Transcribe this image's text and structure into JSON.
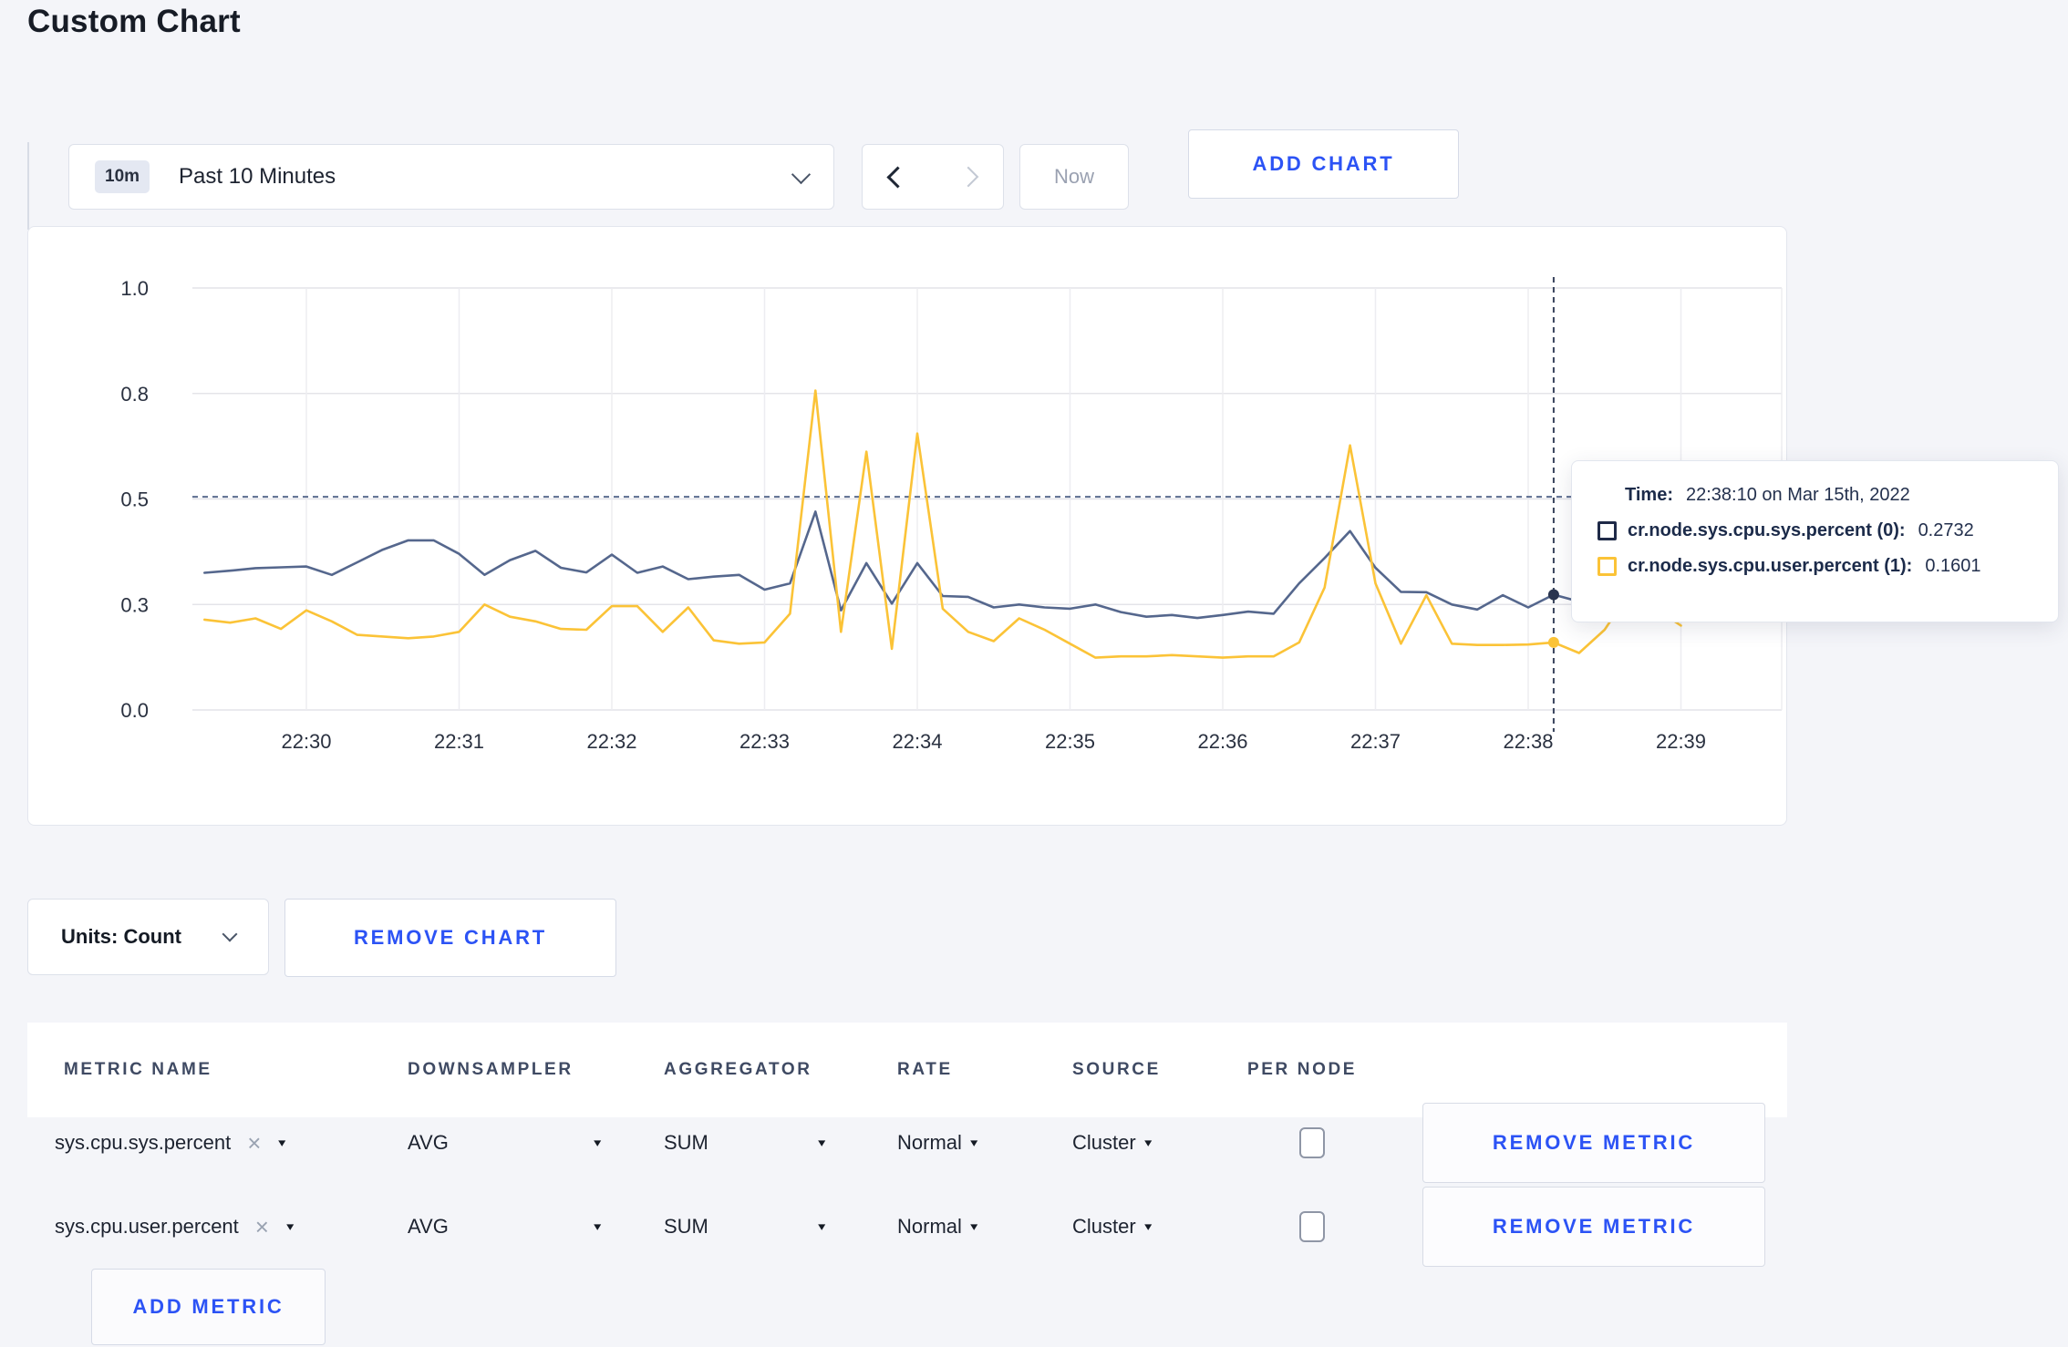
{
  "page": {
    "title": "Custom Chart",
    "background": "#f4f5f9"
  },
  "theme": {
    "accent_blue": "#2C53F5",
    "text_dark": "#1D2330",
    "card_border": "#E3E6EE"
  },
  "toolbar": {
    "time_window_badge": "10m",
    "time_window_label": "Past 10 Minutes",
    "now_label": "Now",
    "add_chart_label": "ADD CHART",
    "icons": {
      "prev": "chevron-left",
      "next": "chevron-right",
      "dropdown": "chevron-down"
    }
  },
  "chart_data": {
    "type": "line",
    "title": "",
    "xlabel": "",
    "ylabel": "",
    "legend_position": "none",
    "grid": true,
    "y_axis": {
      "range": [
        0,
        1
      ],
      "tick_values": [
        0,
        0.25,
        0.5,
        0.75,
        1.0
      ],
      "tick_labels": [
        "0.0",
        "0.3",
        "0.5",
        "0.8",
        "1.0"
      ]
    },
    "x_axis": {
      "ticks": [
        "22:30",
        "22:31",
        "22:32",
        "22:33",
        "22:34",
        "22:35",
        "22:36",
        "22:37",
        "22:38",
        "22:39"
      ]
    },
    "x": [
      "22:29:20",
      "22:29:30",
      "22:29:40",
      "22:29:50",
      "22:30:00",
      "22:30:10",
      "22:30:20",
      "22:30:30",
      "22:30:40",
      "22:30:50",
      "22:31:00",
      "22:31:10",
      "22:31:20",
      "22:31:30",
      "22:31:40",
      "22:31:50",
      "22:32:00",
      "22:32:10",
      "22:32:20",
      "22:32:30",
      "22:32:40",
      "22:32:50",
      "22:33:00",
      "22:33:10",
      "22:33:20",
      "22:33:30",
      "22:33:40",
      "22:33:50",
      "22:34:00",
      "22:34:10",
      "22:34:20",
      "22:34:30",
      "22:34:40",
      "22:34:50",
      "22:35:00",
      "22:35:10",
      "22:35:20",
      "22:35:30",
      "22:35:40",
      "22:35:50",
      "22:36:00",
      "22:36:10",
      "22:36:20",
      "22:36:30",
      "22:36:40",
      "22:36:50",
      "22:37:00",
      "22:37:10",
      "22:37:20",
      "22:37:30",
      "22:37:40",
      "22:37:50",
      "22:38:00",
      "22:38:10",
      "22:38:20",
      "22:38:30",
      "22:38:40",
      "22:38:50",
      "22:39:00"
    ],
    "series": [
      {
        "name": "cr.node.sys.cpu.sys.percent (0)",
        "color": "#55678D",
        "dot_color": "#2A3550",
        "values": [
          0.325,
          0.33,
          0.336,
          0.338,
          0.34,
          0.32,
          0.35,
          0.38,
          0.402,
          0.402,
          0.37,
          0.32,
          0.355,
          0.377,
          0.337,
          0.326,
          0.368,
          0.325,
          0.34,
          0.31,
          0.316,
          0.32,
          0.285,
          0.3,
          0.47,
          0.236,
          0.348,
          0.252,
          0.348,
          0.27,
          0.268,
          0.243,
          0.25,
          0.243,
          0.24,
          0.25,
          0.232,
          0.221,
          0.225,
          0.218,
          0.225,
          0.233,
          0.228,
          0.3,
          0.36,
          0.424,
          0.337,
          0.28,
          0.279,
          0.25,
          0.238,
          0.272,
          0.243,
          0.2732,
          0.257,
          0.27,
          0.29,
          0.28,
          0.285
        ]
      },
      {
        "name": "cr.node.sys.cpu.user.percent (1)",
        "color": "#FBC337",
        "dot_color": "#FBC337",
        "values": [
          0.214,
          0.207,
          0.217,
          0.192,
          0.236,
          0.21,
          0.178,
          0.174,
          0.17,
          0.174,
          0.185,
          0.25,
          0.221,
          0.21,
          0.192,
          0.19,
          0.246,
          0.246,
          0.185,
          0.243,
          0.165,
          0.157,
          0.16,
          0.228,
          0.757,
          0.185,
          0.612,
          0.145,
          0.655,
          0.24,
          0.185,
          0.163,
          0.217,
          0.19,
          0.157,
          0.124,
          0.127,
          0.127,
          0.13,
          0.127,
          0.124,
          0.127,
          0.127,
          0.16,
          0.29,
          0.627,
          0.3,
          0.157,
          0.272,
          0.157,
          0.154,
          0.154,
          0.155,
          0.1601,
          0.135,
          0.19,
          0.28,
          0.24,
          0.2
        ]
      }
    ],
    "hover": {
      "time": "22:38:10",
      "guideline_y": 0.505
    }
  },
  "tooltip": {
    "time_label": "Time:",
    "time_value": "22:38:10 on Mar 15th, 2022",
    "series": [
      {
        "label": "cr.node.sys.cpu.sys.percent (0):",
        "value": "0.2732",
        "swatch_color": "#1F2A48"
      },
      {
        "label": "cr.node.sys.cpu.user.percent (1):",
        "value": "0.1601",
        "swatch_color": "#FBC337"
      }
    ]
  },
  "chart_footer": {
    "units_label": "Units: Count",
    "remove_chart_label": "REMOVE CHART"
  },
  "metrics_table": {
    "headers": [
      "METRIC NAME",
      "DOWNSAMPLER",
      "AGGREGATOR",
      "RATE",
      "SOURCE",
      "PER NODE"
    ],
    "rows": [
      {
        "metric": "sys.cpu.sys.percent",
        "downsampler": "AVG",
        "aggregator": "SUM",
        "rate": "Normal",
        "source": "Cluster",
        "per_node_checked": false,
        "remove_label": "REMOVE METRIC"
      },
      {
        "metric": "sys.cpu.user.percent",
        "downsampler": "AVG",
        "aggregator": "SUM",
        "rate": "Normal",
        "source": "Cluster",
        "per_node_checked": false,
        "remove_label": "REMOVE METRIC"
      }
    ],
    "close_glyph": "×",
    "caret_glyph": "▾",
    "add_metric_label": "ADD METRIC"
  }
}
